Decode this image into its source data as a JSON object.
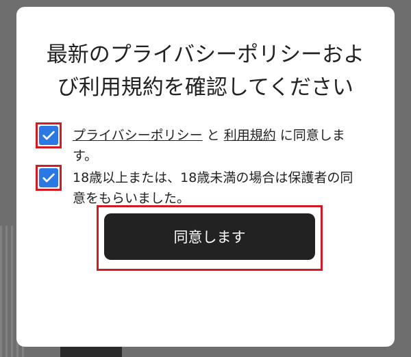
{
  "dialog": {
    "title": "最新のプライバシーポリシーおよび利用規約を確認してください",
    "checkbox1": {
      "link_privacy": "プライバシーポリシー",
      "connector": " と ",
      "link_terms": "利用規約",
      "suffix": " に同意します。",
      "checked": true
    },
    "checkbox2": {
      "text": "18歳以上または、18歳未満の場合は保護者の同意をもらいました。",
      "checked": true
    },
    "agree_button_label": "同意します"
  },
  "colors": {
    "checkbox": "#2b78e4",
    "highlight": "#d01b25",
    "button": "#222222",
    "overlay": "#6e6e6e"
  }
}
